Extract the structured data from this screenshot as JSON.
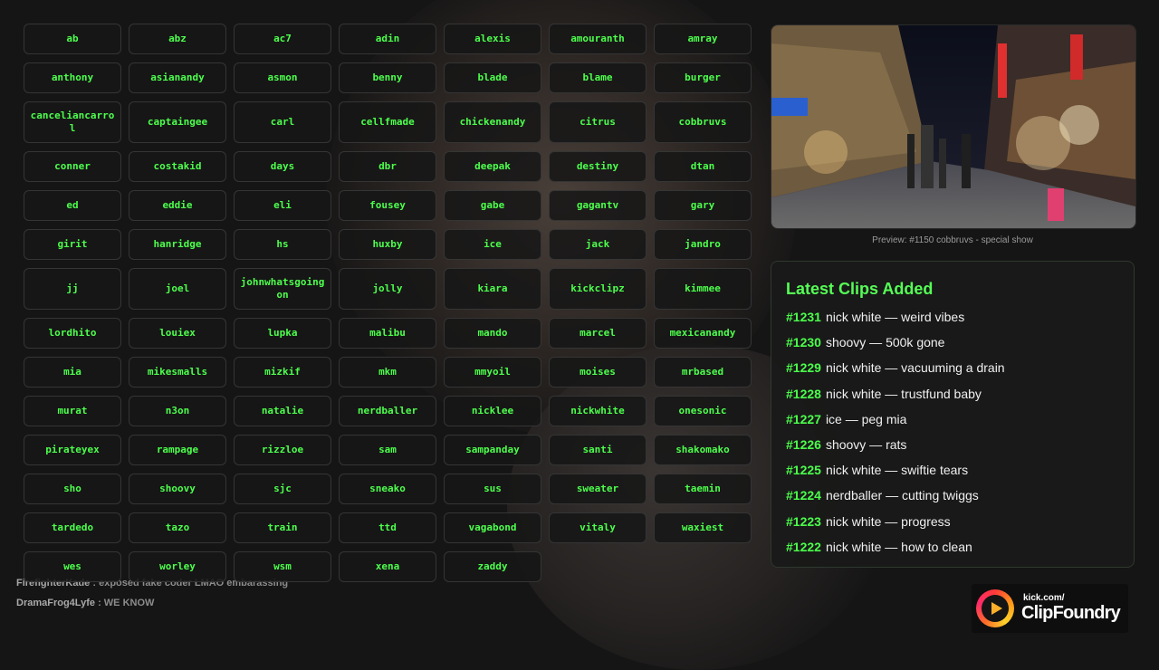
{
  "streamers": [
    "ab",
    "abz",
    "ac7",
    "adin",
    "alexis",
    "amouranth",
    "amray",
    "anthony",
    "asianandy",
    "asmon",
    "benny",
    "blade",
    "blame",
    "burger",
    "canceliancarrol",
    "captaingee",
    "carl",
    "cellfmade",
    "chickenandy",
    "citrus",
    "cobbruvs",
    "conner",
    "costakid",
    "days",
    "dbr",
    "deepak",
    "destiny",
    "dtan",
    "ed",
    "eddie",
    "eli",
    "fousey",
    "gabe",
    "gagantv",
    "gary",
    "girit",
    "hanridge",
    "hs",
    "huxby",
    "ice",
    "jack",
    "jandro",
    "jj",
    "joel",
    "johnwhatsgoingon",
    "jolly",
    "kiara",
    "kickclipz",
    "kimmee",
    "lordhito",
    "louiex",
    "lupka",
    "malibu",
    "mando",
    "marcel",
    "mexicanandy",
    "mia",
    "mikesmalls",
    "mizkif",
    "mkm",
    "mmyoil",
    "moises",
    "mrbased",
    "murat",
    "n3on",
    "natalie",
    "nerdballer",
    "nicklee",
    "nickwhite",
    "onesonic",
    "pirateyex",
    "rampage",
    "rizzloe",
    "sam",
    "sampanday",
    "santi",
    "shakomako",
    "sho",
    "shoovy",
    "sjc",
    "sneako",
    "sus",
    "sweater",
    "taemin",
    "tardedo",
    "tazo",
    "train",
    "ttd",
    "vagabond",
    "vitaly",
    "waxiest",
    "wes",
    "worley",
    "wsm",
    "xena",
    "zaddy"
  ],
  "preview": {
    "caption": "Preview: #1150 cobbruvs - special show"
  },
  "clips": {
    "title": "Latest Clips Added",
    "items": [
      {
        "num": "#1231",
        "text": "nick white — weird vibes"
      },
      {
        "num": "#1230",
        "text": "shoovy — 500k gone"
      },
      {
        "num": "#1229",
        "text": "nick white — vacuuming a drain"
      },
      {
        "num": "#1228",
        "text": "nick white — trustfund baby"
      },
      {
        "num": "#1227",
        "text": "ice — peg mia"
      },
      {
        "num": "#1226",
        "text": "shoovy — rats"
      },
      {
        "num": "#1225",
        "text": "nick white — swiftie tears"
      },
      {
        "num": "#1224",
        "text": "nerdballer — cutting twiggs"
      },
      {
        "num": "#1223",
        "text": "nick white — progress"
      },
      {
        "num": "#1222",
        "text": "nick white — how to clean"
      }
    ]
  },
  "chat": [
    {
      "user": "FirefighterKade",
      "text": "exposed fake coder LMAO embarassing"
    },
    {
      "user": "DramaFrog4Lyfe",
      "text": "WE KNOW"
    }
  ],
  "logo": {
    "small": "kick.com/",
    "big": "ClipFoundry"
  },
  "colors": {
    "accent": "#4cff4c",
    "title": "#56ff56",
    "background": "#151515"
  }
}
